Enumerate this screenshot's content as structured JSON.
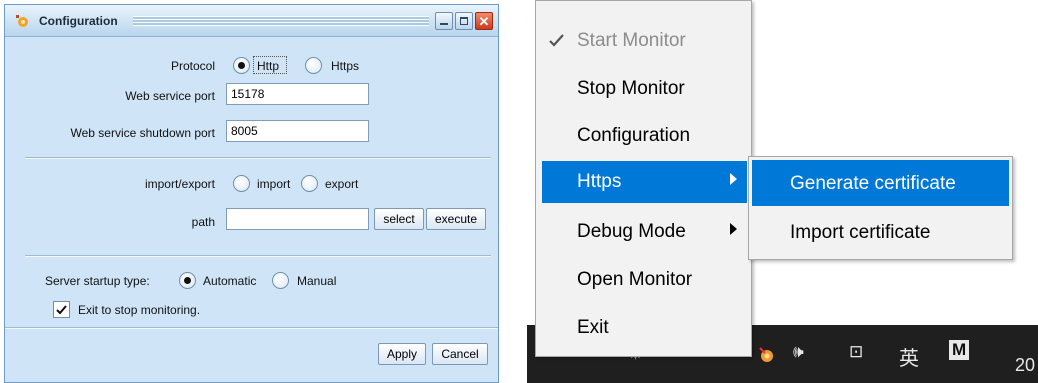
{
  "dialog": {
    "title": "Configuration",
    "protocol_label": "Protocol",
    "protocol_options": [
      {
        "label": "Http",
        "selected": true
      },
      {
        "label": "Https",
        "selected": false
      }
    ],
    "web_port_label": "Web service port",
    "web_port_value": "15178",
    "shutdown_port_label": "Web service shutdown port",
    "shutdown_port_value": "8005",
    "import_export_label": "import/export",
    "import_export_options": [
      {
        "label": "import",
        "selected": false
      },
      {
        "label": "export",
        "selected": false
      }
    ],
    "path_label": "path",
    "path_value": "",
    "select_label": "select",
    "execute_label": "execute",
    "startup_label": "Server startup type:",
    "startup_options": [
      {
        "label": "Automatic",
        "selected": true
      },
      {
        "label": "Manual",
        "selected": false
      }
    ],
    "exit_checkbox_label": "Exit to stop monitoring.",
    "exit_checkbox_checked": true,
    "apply_label": "Apply",
    "cancel_label": "Cancel"
  },
  "menu": {
    "items": [
      {
        "label": "Start Monitor",
        "disabled": true,
        "checked": true
      },
      {
        "label": "Stop Monitor"
      },
      {
        "label": "Configuration"
      },
      {
        "label": "Https",
        "highlighted": true,
        "has_submenu": true
      },
      {
        "label": "Debug Mode",
        "has_submenu": true
      },
      {
        "label": "Open Monitor"
      },
      {
        "label": "Exit"
      }
    ],
    "submenu_items": [
      {
        "label": "Generate certificate",
        "highlighted": true
      },
      {
        "label": "Import certificate"
      }
    ]
  },
  "taskbar": {
    "ime_label": "英",
    "m_label": "M",
    "clock_partial": "20"
  },
  "colors": {
    "dialog_bg": "#cfe5f7",
    "menu_highlight": "#0078d7",
    "taskbar_bg": "#1f1f1f"
  }
}
